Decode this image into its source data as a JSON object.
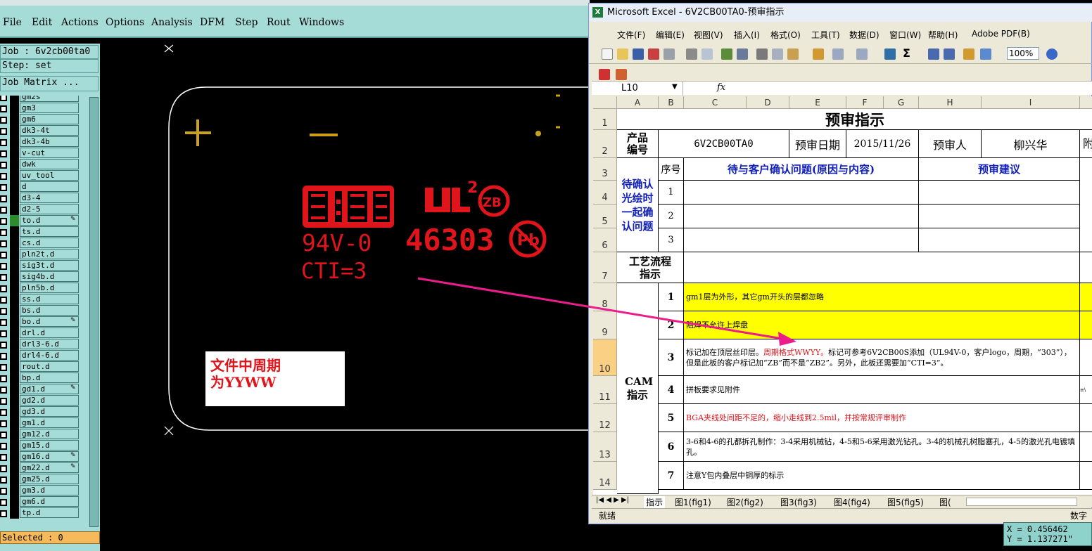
{
  "cam": {
    "menu": [
      "File",
      "Edit",
      "Actions",
      "Options",
      "Analysis",
      "DFM",
      "Step",
      "Rout",
      "Windows"
    ],
    "job": "Job : 6v2cb00ta0",
    "step": "Step: set",
    "job_matrix": "Job Matrix ...",
    "layers": [
      "gm2s",
      "gm3",
      "gm6",
      "dk3-4t",
      "dk3-4b",
      "v-cut",
      "dwk",
      "uv_tool",
      "d",
      "d3-4",
      "d2-5",
      "to.d",
      "ts.d",
      "cs.d",
      "pln2t.d",
      "sig3t.d",
      "sig4b.d",
      "pln5b.d",
      "ss.d",
      "bs.d",
      "bo.d",
      "drl.d",
      "drl3-6.d",
      "drl4-6.d",
      "rout.d",
      "bp.d",
      "gd1.d",
      "gd2.d",
      "gd3.d",
      "gm1.d",
      "gm12.d",
      "gm15.d",
      "gm16.d",
      "gm22.d",
      "gm25.d",
      "gm3.d",
      "gm6.d",
      "tp.d"
    ],
    "selected": "Selected : 0",
    "marking_rating": "94V-0",
    "marking_cti": "CTI=3",
    "marking_code": "46303",
    "marking_ul_sup": "2",
    "marking_zb": "ZB",
    "marking_pb": "Pb",
    "note_line1": "文件中周期",
    "note_line2": "为YYWW",
    "coord_x": "X =  0.456462",
    "coord_y": "Y =  1.137271\""
  },
  "excel": {
    "title": "Microsoft Excel - 6V2CB00TA0-预审指示",
    "menu": [
      "文件(F)",
      "编辑(E)",
      "视图(V)",
      "插入(I)",
      "格式(O)",
      "工具(T)",
      "数据(D)",
      "窗口(W)",
      "帮助(H)",
      "Adobe PDF(B)"
    ],
    "zoom": "100%",
    "namebox": "L10",
    "fx": "fx",
    "columns": [
      "A",
      "B",
      "C",
      "D",
      "E",
      "F",
      "G",
      "H",
      "I"
    ],
    "rows": [
      "1",
      "2",
      "3",
      "4",
      "5",
      "6",
      "7",
      "8",
      "9",
      "10",
      "11",
      "12",
      "13",
      "14"
    ],
    "sheet_title": "预审指示",
    "product_label": "产品编号",
    "product_no": "6V2CB00TA0",
    "date_label": "预审日期",
    "date": "2015/11/26",
    "reviewer_label": "预审人",
    "reviewer": "柳兴华",
    "attach_label": "附",
    "confirm_label": "待确认光绘时一起确认问题",
    "seq_label": "序号",
    "issue_label": "待与客户确认问题(原因与内容)",
    "advice_label": "预审建议",
    "seq": [
      "1",
      "2",
      "3"
    ],
    "flow_label": "工艺流程指示",
    "cam_label": "CAM指示",
    "instructions": [
      {
        "n": "1",
        "text": "gm1层为外形，其它gm开头的层都忽略"
      },
      {
        "n": "2",
        "text": "阻焊不允许上焊盘"
      },
      {
        "n": "3",
        "pre": "标记加在顶层丝印层。",
        "red": "周期格式WWYY。",
        "post": "标记可参考6V2CB00S添加（UL94V-0，客户logo，周期，“303”），但是此板的客户标记加“ZB”而不是“ZB2”。另外，此板还需要加“CTI=3”。"
      },
      {
        "n": "4",
        "text": "拼板要求见附件"
      },
      {
        "n": "5",
        "text": "BGA夹线处间距不足的，缩小走线到2.5mil，并按常规评审制作"
      },
      {
        "n": "6",
        "text": "3-6和4-6的孔都拆孔制作：3-4采用机械钻，4-5和5-6采用激光钻孔。3-4的机械孔树脂塞孔，4-5的激光孔电镀填孔。"
      },
      {
        "n": "7",
        "text": "注意Y包内叠层中铜厚的标示"
      }
    ],
    "sheet_tabs": [
      "指示",
      "图1(fig1)",
      "图2(fig2)",
      "图3(fig3)",
      "图4(fig4)",
      "图5(fig5)",
      "图("
    ],
    "status": "就绪",
    "status_right": "数字",
    "attach_note": "≡\\"
  }
}
